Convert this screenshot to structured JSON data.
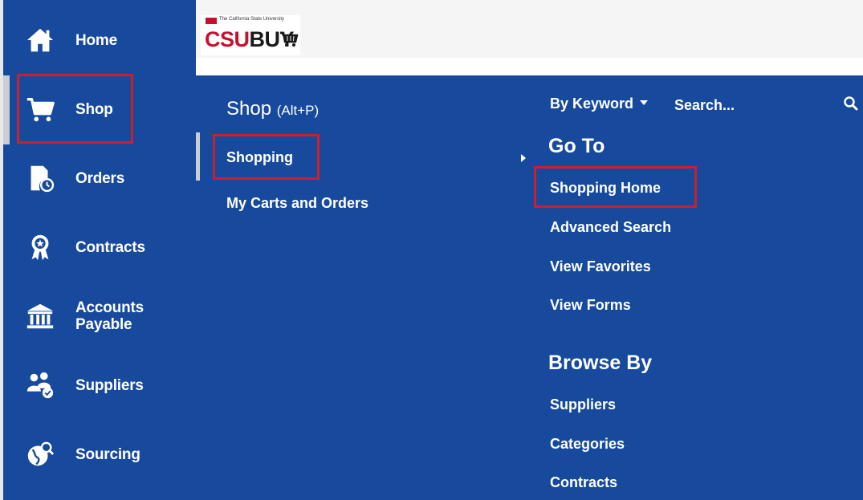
{
  "logo": {
    "main_prefix": "CSU",
    "main_suffix": "BUY",
    "subtitle": "The California State University"
  },
  "sidebar": {
    "items": [
      {
        "label": "Home",
        "icon": "home-icon"
      },
      {
        "label": "Shop",
        "icon": "cart-icon",
        "active": true
      },
      {
        "label": "Orders",
        "icon": "orders-clock-icon"
      },
      {
        "label": "Contracts",
        "icon": "contract-ribbon-icon"
      },
      {
        "label": "Accounts Payable",
        "icon": "bank-icon"
      },
      {
        "label": "Suppliers",
        "icon": "suppliers-users-icon"
      },
      {
        "label": "Sourcing",
        "icon": "sourcing-globe-icon"
      }
    ]
  },
  "panel": {
    "title": "Shop",
    "hotkey": "(Alt+P)",
    "menu": [
      {
        "label": "Shopping",
        "selected": true
      },
      {
        "label": "My Carts and Orders"
      }
    ],
    "search": {
      "mode_label": "By Keyword",
      "placeholder": "Search..."
    },
    "goto": {
      "heading": "Go To",
      "links": [
        "Shopping Home",
        "Advanced Search",
        "View Favorites",
        "View Forms"
      ]
    },
    "browse": {
      "heading": "Browse By",
      "links": [
        "Suppliers",
        "Categories",
        "Contracts"
      ]
    }
  },
  "colors": {
    "nav_blue": "#174a9c",
    "highlight_red": "#cc1f2d",
    "brand_red": "#c8102e"
  }
}
